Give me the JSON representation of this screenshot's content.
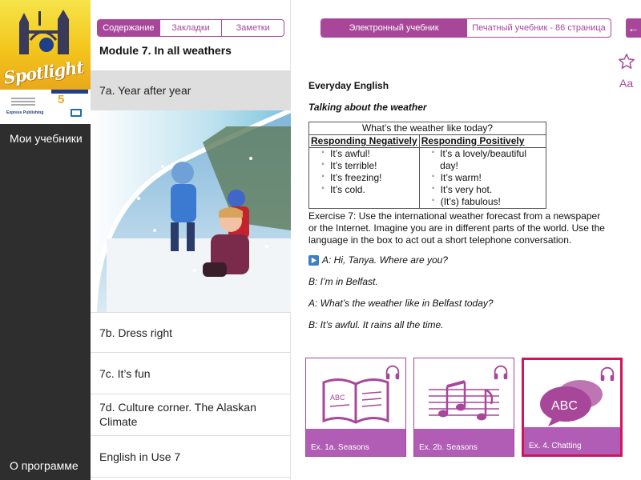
{
  "sidebar": {
    "cover": {
      "title": "Spotlight",
      "grade": "5",
      "publisher": "Express Publishing"
    },
    "my_books": "Мои учебники",
    "about": "О программе"
  },
  "toc": {
    "tabs": [
      {
        "label": "Содержание",
        "active": true
      },
      {
        "label": "Закладки",
        "active": false
      },
      {
        "label": "Заметки",
        "active": false
      }
    ],
    "module_title": "Module 7. In all weathers",
    "items": [
      {
        "label": "7a. Year after year",
        "selected": true
      },
      {
        "label": "7b. Dress right"
      },
      {
        "label": "7c. It’s fun"
      },
      {
        "label": "7d. Culture corner. The Alaskan Climate"
      },
      {
        "label": "English in Use 7"
      }
    ]
  },
  "view_toggle": {
    "electronic": "Электронный учебник",
    "printed": "Печатный учебник - 86 страница"
  },
  "tools": {
    "font_size": "Aa"
  },
  "content": {
    "heading": "Everyday English",
    "subheading": "Talking about the weather",
    "table": {
      "caption": "What’s the weather like today?",
      "col_negative": "Responding Negatively",
      "col_positive": "Responding Positively",
      "negative": [
        "It’s awful!",
        "It’s terrible!",
        "It’s freezing!",
        "It’s cold."
      ],
      "positive": [
        "It’s a lovely/beautiful day!",
        "It’s warm!",
        "It’s very hot.",
        "(It’s) fabulous!"
      ]
    },
    "exercise": "Exercise 7: Use the international weather forecast from a newspaper or the Internet. Imagine you are in different parts of the world. Use the language in the box to act out a short telephone conversation.",
    "dialog": [
      "A: Hi, Tanya. Where are you?",
      "B: I’m in Belfast.",
      "A: What’s the weather like in Belfast today?",
      "B: It’s awful. It rains all the time."
    ]
  },
  "cards": [
    {
      "label": "Ex. 1a. Seasons",
      "icon": "book-abc-icon",
      "active": false
    },
    {
      "label": "Ex. 2b. Seasons",
      "icon": "music-notes-icon",
      "active": false
    },
    {
      "label": "Ex. 4. Chatting",
      "icon": "speech-bubble-abc-icon",
      "active": true
    }
  ],
  "colors": {
    "accent": "#a8479a",
    "active_card": "#d4145a",
    "sidebar": "#2e2e2e",
    "card_footer": "#b15db5"
  }
}
